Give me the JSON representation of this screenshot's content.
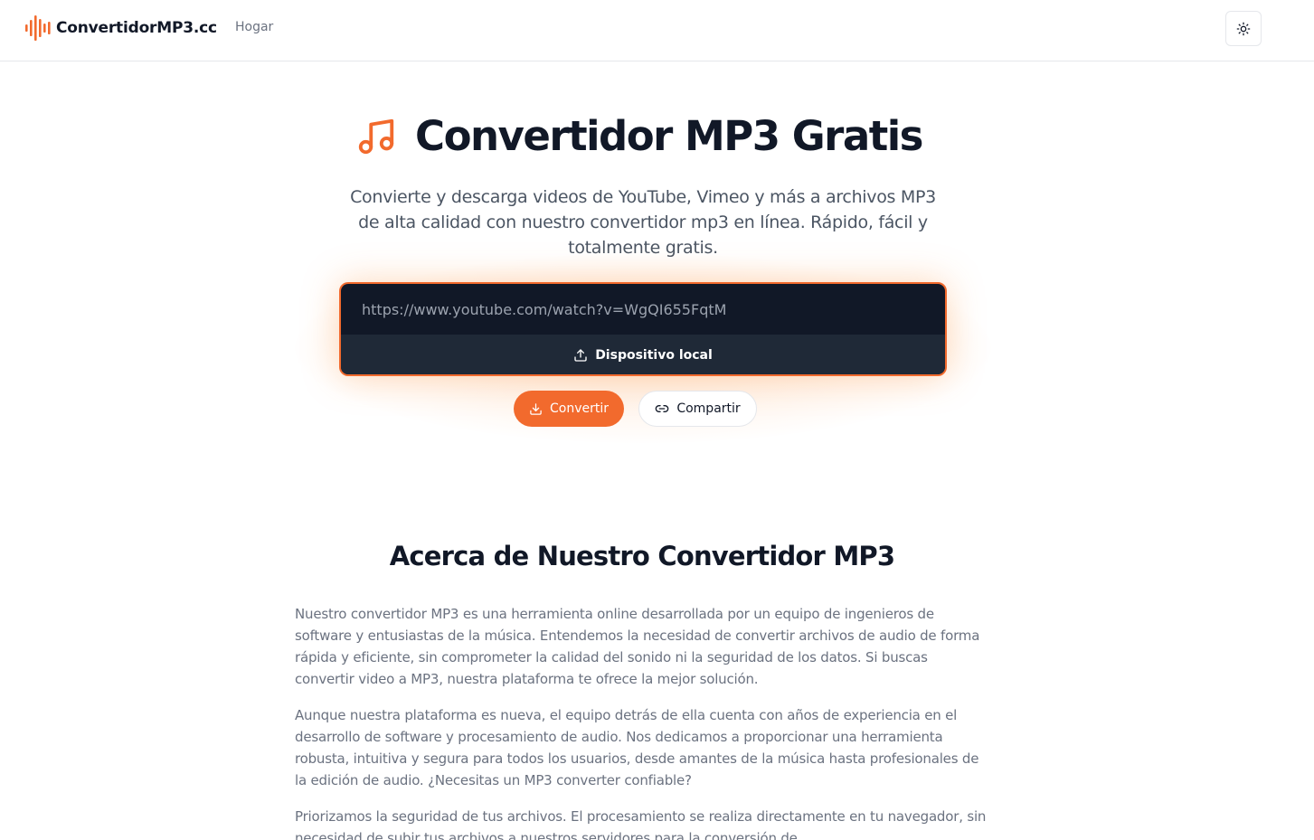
{
  "header": {
    "brand": "ConvertidorMP3.cc",
    "nav_home": "Hogar",
    "theme_toggle_icon": "sun-icon"
  },
  "hero": {
    "title": "Convertidor MP3 Gratis",
    "title_icon": "music-note-icon",
    "subtitle": "Convierte y descarga videos de YouTube, Vimeo y más a archivos MP3 de alta calidad con nuestro convertidor mp3 en línea. Rápido, fácil y totalmente gratis."
  },
  "converter": {
    "url_placeholder": "https://www.youtube.com/watch?v=WgQI655FqtM",
    "local_device_label": "Dispositivo local",
    "convert_label": "Convertir",
    "share_label": "Compartir"
  },
  "about": {
    "title": "Acerca de Nuestro Convertidor MP3",
    "paragraphs": [
      "Nuestro convertidor MP3 es una herramienta online desarrollada por un equipo de ingenieros de software y entusiastas de la música. Entendemos la necesidad de convertir archivos de audio de forma rápida y eficiente, sin comprometer la calidad del sonido ni la seguridad de los datos. Si buscas convertir video a MP3, nuestra plataforma te ofrece la mejor solución.",
      "Aunque nuestra plataforma es nueva, el equipo detrás de ella cuenta con años de experiencia en el desarrollo de software y procesamiento de audio. Nos dedicamos a proporcionar una herramienta robusta, intuitiva y segura para todos los usuarios, desde amantes de la música hasta profesionales de la edición de audio. ¿Necesitas un MP3 converter confiable?",
      "Priorizamos la seguridad de tus archivos. El procesamiento se realiza directamente en tu navegador, sin necesidad de subir tus archivos a nuestros servidores para la conversión de"
    ]
  },
  "colors": {
    "accent": "#f26a2d",
    "dark": "#111827",
    "text_muted": "#6b7280"
  }
}
